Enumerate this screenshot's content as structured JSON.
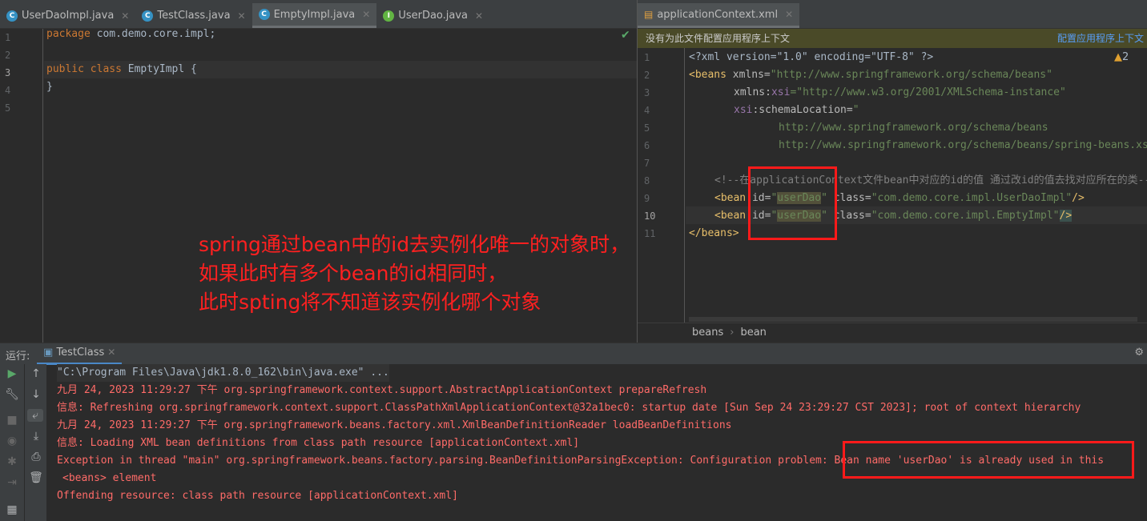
{
  "left_editor": {
    "tabs": [
      {
        "label": "UserDaoImpl.java",
        "icon": "C",
        "color": "#3592c4"
      },
      {
        "label": "TestClass.java",
        "icon": "C",
        "color": "#3592c4"
      },
      {
        "label": "EmptyImpl.java",
        "icon": "C",
        "color": "#3592c4",
        "active": true
      },
      {
        "label": "UserDao.java",
        "icon": "I",
        "color": "#62b543"
      }
    ],
    "line_numbers": [
      "1",
      "2",
      "3",
      "4",
      "5"
    ],
    "code": {
      "l1_kw": "package",
      "l1_rest": " com.demo.core.impl;",
      "l3_kw1": "public",
      "l3_kw2": "class",
      "l3_rest": " EmptyImpl {",
      "l4": "}"
    }
  },
  "right_editor": {
    "tab": "applicationContext.xml",
    "banner": "没有为此文件配置应用程序上下文",
    "banner_link": "配置应用程序上下文",
    "warnings": "2",
    "line_numbers": [
      "1",
      "2",
      "3",
      "4",
      "5",
      "6",
      "7",
      "8",
      "9",
      "10",
      "11"
    ],
    "code": {
      "l1": "<?xml version=\"1.0\" encoding=\"UTF-8\" ?>",
      "l2_tag": "<beans",
      "l2_attr": " xmlns=",
      "l2_val": "\"http://www.springframework.org/schema/beans\"",
      "l3_attr": "xmlns:",
      "l3_ns": "xsi",
      "l3_val": "=\"http://www.w3.org/2001/XMLSchema-instance\"",
      "l4_ns": "xsi",
      "l4_attr": ":schemaLocation=",
      "l4_val": "\"",
      "l5": "http://www.springframework.org/schema/beans",
      "l6": "http://www.springframework.org/schema/beans/spring-beans.xsd",
      "l8": "<!--在applicationContext文件bean中对应的id的值 通过改id的值去找对应所在的类-->",
      "l9_tag": "<bean",
      "l9_id": " id=",
      "l9_q": "\"",
      "l9_idv": "userDao",
      "l9_class": " class=",
      "l9_cv": "\"com.demo.core.impl.UserDaoImpl\"",
      "l9_end": "/>",
      "l10_tag": "<bean",
      "l10_cv": "\"com.demo.core.impl.EmptyImpl\"",
      "l11": "</beans>"
    },
    "breadcrumb": [
      "beans",
      "bean"
    ]
  },
  "annotation": [
    "spring通过bean中的id去实例化唯一的对象时，",
    "如果此时有多个bean的id相同时，",
    "此时spting将不知道该实例化哪个对象"
  ],
  "run_panel": {
    "label": "运行:",
    "tab": "TestClass",
    "console": [
      "\"C:\\Program Files\\Java\\jdk1.8.0_162\\bin\\java.exe\" ...",
      "九月 24, 2023 11:29:27 下午 org.springframework.context.support.AbstractApplicationContext prepareRefresh",
      "信息: Refreshing org.springframework.context.support.ClassPathXmlApplicationContext@32a1bec0: startup date [Sun Sep 24 23:29:27 CST 2023]; root of context hierarchy",
      "九月 24, 2023 11:29:27 下午 org.springframework.beans.factory.xml.XmlBeanDefinitionReader loadBeanDefinitions",
      "信息: Loading XML bean definitions from class path resource [applicationContext.xml]",
      "Exception in thread \"main\" org.springframework.beans.factory.parsing.BeanDefinitionParsingException: Configuration problem: Bean name 'userDao' is already used in this",
      "<beans> element",
      "Offending resource: class path resource [applicationContext.xml]"
    ]
  }
}
